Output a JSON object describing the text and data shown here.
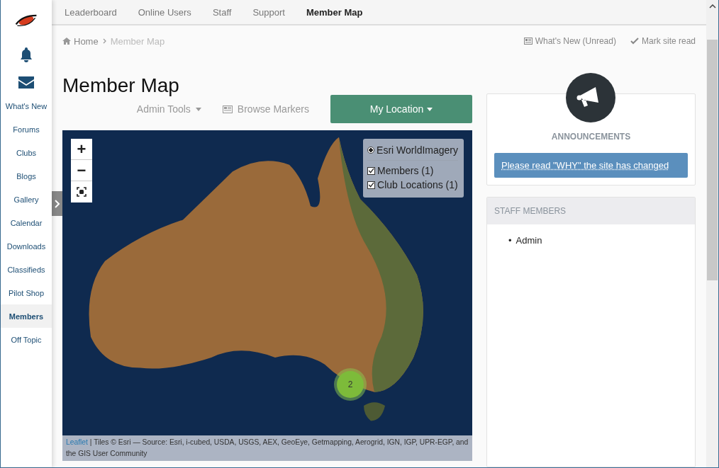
{
  "sidebar": {
    "items": [
      {
        "label": "What's New",
        "selected": false
      },
      {
        "label": "Forums",
        "selected": false
      },
      {
        "label": "Clubs",
        "selected": false
      },
      {
        "label": "Blogs",
        "selected": false
      },
      {
        "label": "Gallery",
        "selected": false
      },
      {
        "label": "Calendar",
        "selected": false
      },
      {
        "label": "Downloads",
        "selected": false
      },
      {
        "label": "Classifieds",
        "selected": false
      },
      {
        "label": "Pilot Shop",
        "selected": false
      },
      {
        "label": "Members",
        "selected": true
      },
      {
        "label": "Off Topic",
        "selected": false
      }
    ]
  },
  "top_nav": {
    "tabs": [
      {
        "label": "Leaderboard",
        "selected": false
      },
      {
        "label": "Online Users",
        "selected": false
      },
      {
        "label": "Staff",
        "selected": false
      },
      {
        "label": "Support",
        "selected": false
      },
      {
        "label": "Member Map",
        "selected": true
      }
    ]
  },
  "breadcrumb": [
    "Home",
    "Member Map"
  ],
  "header_links": [
    {
      "kind": "news",
      "label": "What's New (Unread)"
    },
    {
      "kind": "check",
      "label": "Mark site read"
    }
  ],
  "page_title": "Member Map",
  "toolbar": {
    "admin_tools": "Admin Tools",
    "browse_markers": "Browse Markers",
    "my_location": "My Location"
  },
  "map": {
    "zoom_in": "+",
    "zoom_out": "−",
    "base_layers": [
      {
        "label": "Esri WorldImagery",
        "selected": true
      }
    ],
    "overlays": [
      {
        "label": "Members (1)",
        "checked": true
      },
      {
        "label": "Club Locations (1)",
        "checked": true
      }
    ],
    "cluster": "2",
    "attribution": {
      "link": "Leaflet",
      "text": " | Tiles © Esri — Source: Esri, i-cubed, USDA, USGS, AEX, GeoEye, Getmapping, Aerogrid, IGN, IGP, UPR-EGP, and the GIS User Community"
    }
  },
  "announcements": {
    "title": "ANNOUNCEMENTS",
    "items": [
      "Please read \"WHY\" the site has changed"
    ]
  },
  "staff": {
    "title": "STAFF MEMBERS",
    "members": [
      {
        "bullet": "•",
        "name": "Admin"
      }
    ]
  }
}
